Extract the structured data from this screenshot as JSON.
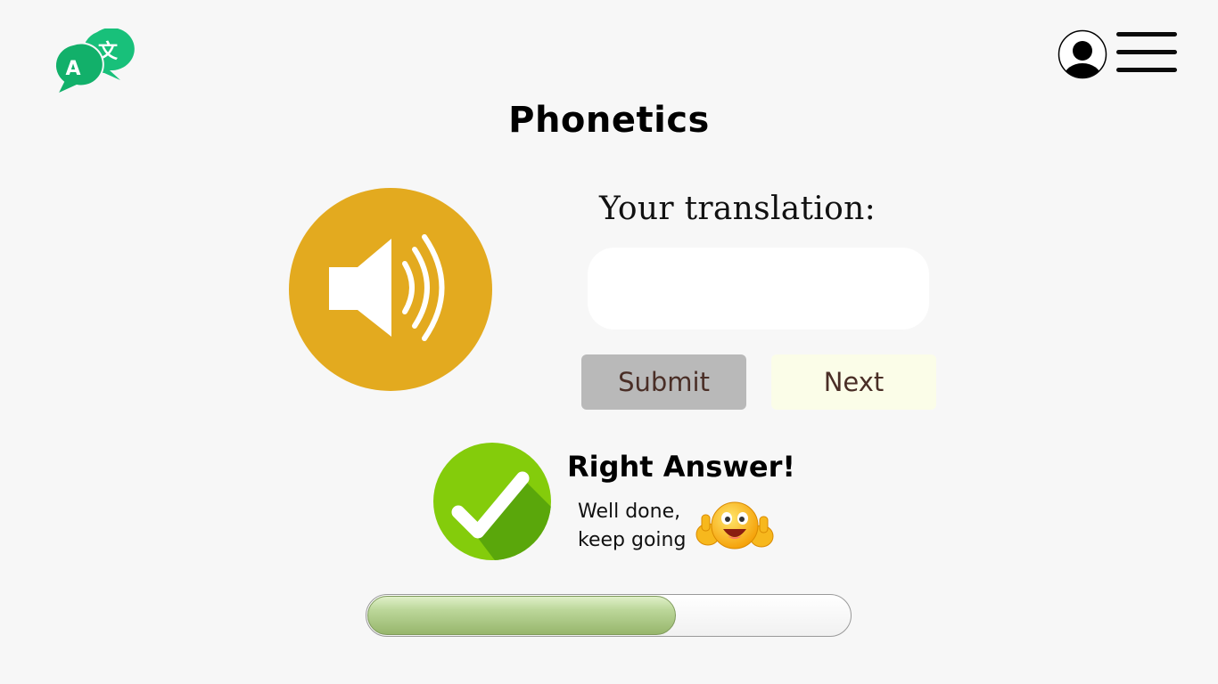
{
  "app": {
    "logo_icon": "translate-chat-bubbles-icon",
    "logo_letters": [
      "A",
      "文"
    ],
    "brand_color": "#18c07a"
  },
  "header": {
    "profile_icon": "user-avatar-icon",
    "menu_icon": "hamburger-menu-icon"
  },
  "page": {
    "title": "Phonetics"
  },
  "exercise": {
    "speaker_icon": "speaker-volume-icon",
    "speaker_color": "#e3aa1f",
    "translation_label": "Your translation:",
    "input_value": "",
    "input_placeholder": ""
  },
  "actions": {
    "submit_label": "Submit",
    "next_label": "Next"
  },
  "feedback": {
    "icon": "checkmark-icon",
    "title": "Right Answer!",
    "message_line1": "Well done,",
    "message_line2": "keep going",
    "emoji": "thumbs-up-emoji"
  },
  "progress": {
    "fraction": 0.64
  }
}
